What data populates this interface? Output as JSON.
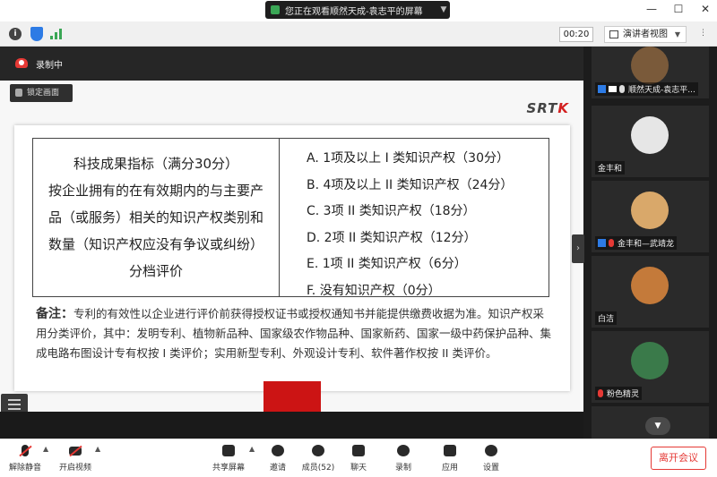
{
  "titlebar": {
    "share_text": "您正在观看顺然天成-袁志平的屏幕",
    "window_buttons": [
      "—",
      "☐",
      "✕"
    ]
  },
  "infobar": {
    "timer": "00:20",
    "view_mode": "演讲者视图"
  },
  "main": {
    "recording_label": "录制中",
    "lock_label": "锁定画面"
  },
  "slide": {
    "logo_text": "SRT",
    "logo_accent": "K",
    "table": {
      "left_lines": [
        "科技成果指标（满分30分）",
        "按企业拥有的在有效期内的与主要产",
        "品（或服务）相关的知识产权类别和",
        "数量（知识产权应没有争议或纠纷）",
        "分档评价"
      ],
      "options": [
        "A.  1项及以上 I 类知识产权（30分）",
        "B.  4项及以上 II 类知识产权（24分）",
        "C.  3项 II 类知识产权（18分）",
        "D.  2项 II 类知识产权（12分）",
        "E.  1项 II 类知识产权（6分）",
        "F.  没有知识产权（0分）"
      ]
    },
    "note_label": "备注：",
    "note_text": "专利的有效性以企业进行评价前获得授权证书或授权通知书并能提供缴费收据为准。知识产权采用分类评价，其中：发明专利、植物新品种、国家级农作物品种、国家新药、国家一级中药保护品种、集成电路布图设计专有权按 I 类评价；实用新型专利、外观设计专利、软件著作权按 II 类评价。"
  },
  "participants": [
    {
      "name": "顺然天成-袁志平...",
      "avatar_color": "#7a5a3a",
      "muted": false
    },
    {
      "name": "金丰和",
      "avatar_color": "#e6e6e6",
      "muted": false
    },
    {
      "name": "金丰和—武靖龙",
      "avatar_color": "#d9a86a",
      "muted": true
    },
    {
      "name": "白洁",
      "avatar_color": "#c47a3a",
      "muted": false
    },
    {
      "name": "粉色精灵",
      "avatar_color": "#3a7a4a",
      "muted": true
    }
  ],
  "toolbar": {
    "unmute": "解除静音",
    "start_video": "开启视频",
    "share_screen": "共享屏幕",
    "invite": "邀请",
    "members": "成员(52)",
    "chat": "聊天",
    "record": "录制",
    "apps": "应用",
    "settings": "设置",
    "leave": "离开会议"
  }
}
